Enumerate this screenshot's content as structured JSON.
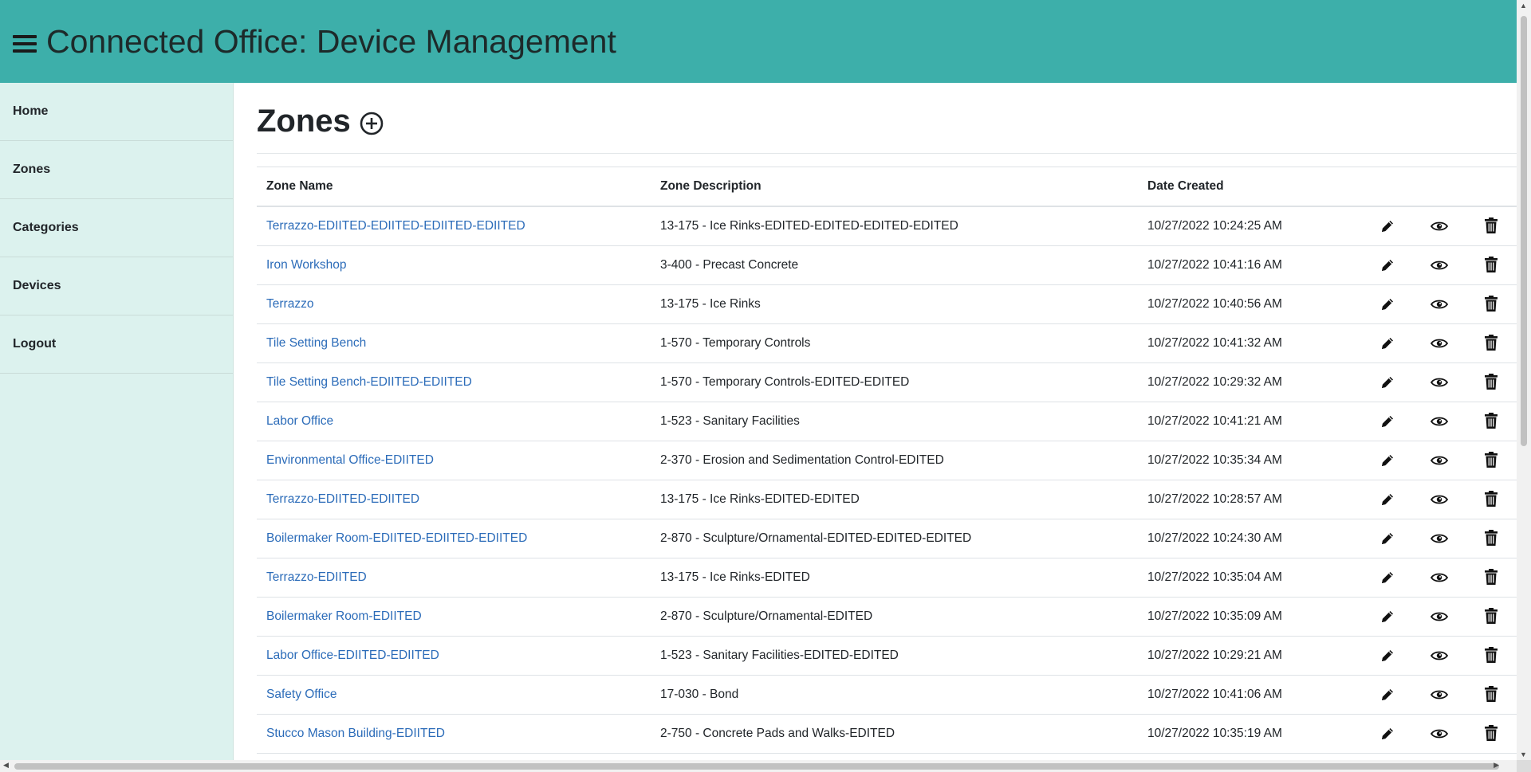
{
  "app": {
    "title": "Connected Office: Device Management"
  },
  "sidebar": {
    "items": [
      {
        "label": "Home"
      },
      {
        "label": "Zones"
      },
      {
        "label": "Categories"
      },
      {
        "label": "Devices"
      },
      {
        "label": "Logout"
      }
    ]
  },
  "page": {
    "title": "Zones"
  },
  "table": {
    "headers": {
      "name": "Zone Name",
      "description": "Zone Description",
      "created": "Date Created"
    },
    "rows": [
      {
        "name": "Terrazzo-EDIITED-EDIITED-EDIITED-EDIITED",
        "description": "13-175 - Ice Rinks-EDITED-EDITED-EDITED-EDITED",
        "created": "10/27/2022 10:24:25 AM"
      },
      {
        "name": "Iron Workshop",
        "description": "3-400 - Precast Concrete",
        "created": "10/27/2022 10:41:16 AM"
      },
      {
        "name": "Terrazzo",
        "description": "13-175 - Ice Rinks",
        "created": "10/27/2022 10:40:56 AM"
      },
      {
        "name": "Tile Setting Bench",
        "description": "1-570 - Temporary Controls",
        "created": "10/27/2022 10:41:32 AM"
      },
      {
        "name": "Tile Setting Bench-EDIITED-EDIITED",
        "description": "1-570 - Temporary Controls-EDITED-EDITED",
        "created": "10/27/2022 10:29:32 AM"
      },
      {
        "name": "Labor Office",
        "description": "1-523 - Sanitary Facilities",
        "created": "10/27/2022 10:41:21 AM"
      },
      {
        "name": "Environmental Office-EDIITED",
        "description": "2-370 - Erosion and Sedimentation Control-EDITED",
        "created": "10/27/2022 10:35:34 AM"
      },
      {
        "name": "Terrazzo-EDIITED-EDIITED",
        "description": "13-175 - Ice Rinks-EDITED-EDITED",
        "created": "10/27/2022 10:28:57 AM"
      },
      {
        "name": "Boilermaker Room-EDIITED-EDIITED-EDIITED",
        "description": "2-870 - Sculpture/Ornamental-EDITED-EDITED-EDITED",
        "created": "10/27/2022 10:24:30 AM"
      },
      {
        "name": "Terrazzo-EDIITED",
        "description": "13-175 - Ice Rinks-EDITED",
        "created": "10/27/2022 10:35:04 AM"
      },
      {
        "name": "Boilermaker Room-EDIITED",
        "description": "2-870 - Sculpture/Ornamental-EDITED",
        "created": "10/27/2022 10:35:09 AM"
      },
      {
        "name": "Labor Office-EDIITED-EDIITED",
        "description": "1-523 - Sanitary Facilities-EDITED-EDITED",
        "created": "10/27/2022 10:29:21 AM"
      },
      {
        "name": "Safety Office",
        "description": "17-030 - Bond",
        "created": "10/27/2022 10:41:06 AM"
      },
      {
        "name": "Stucco Mason Building-EDIITED",
        "description": "2-750 - Concrete Pads and Walks-EDITED",
        "created": "10/27/2022 10:35:19 AM"
      }
    ],
    "row_actions": [
      "pencil-icon",
      "eye-icon",
      "trash-icon"
    ]
  },
  "colors": {
    "header_bg": "#3dafaa",
    "sidebar_bg": "#dcf2ee",
    "link": "#2c6cb9"
  }
}
